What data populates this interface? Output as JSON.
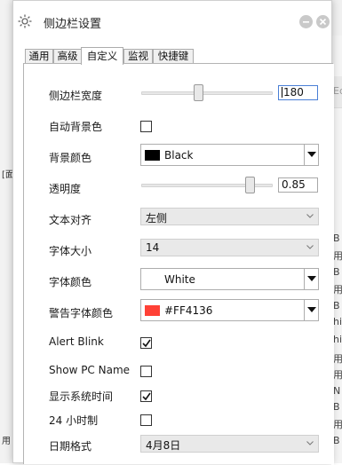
{
  "window": {
    "title": "侧边栏设置"
  },
  "tabs": [
    {
      "label": "通用",
      "active": false
    },
    {
      "label": "高级",
      "active": false
    },
    {
      "label": "自定义",
      "active": true
    },
    {
      "label": "监视",
      "active": false
    },
    {
      "label": "快捷键",
      "active": false
    }
  ],
  "settings": {
    "sidebar_width": {
      "label": "侧边栏宽度",
      "value": "180",
      "slider_fraction": 0.42
    },
    "auto_bg": {
      "label": "自动背景色",
      "checked": false
    },
    "bg_color": {
      "label": "背景颜色",
      "value": "Black",
      "swatch": "#000000"
    },
    "opacity": {
      "label": "透明度",
      "value": "0.85",
      "slider_fraction": 0.85
    },
    "text_align": {
      "label": "文本对齐",
      "value": "左侧"
    },
    "font_size": {
      "label": "字体大小",
      "value": "14"
    },
    "font_color": {
      "label": "字体颜色",
      "value": "White",
      "swatch": "#ffffff"
    },
    "warn_color": {
      "label": "警告字体颜色",
      "value": "#FF4136",
      "swatch": "#FF4136"
    },
    "alert_blink": {
      "label": "Alert Blink",
      "checked": true
    },
    "show_pc_name": {
      "label": "Show PC Name",
      "checked": false
    },
    "show_time": {
      "label": "显示系统时间",
      "checked": true
    },
    "hour24": {
      "label": "24 小时制",
      "checked": false
    },
    "date_format": {
      "label": "日期格式",
      "value": "4月8日"
    }
  },
  "background_app": {
    "fragments": [
      "Ed",
      "B",
      "用f",
      "B",
      "用f",
      "B",
      "hiC",
      "hiC",
      "用f",
      "用f",
      "N",
      "B",
      "用f",
      "B"
    ],
    "left_fragments": [
      "[面",
      "用"
    ]
  },
  "colors": {
    "accent_focus": "#4a7fd6",
    "warn": "#FF4136"
  }
}
